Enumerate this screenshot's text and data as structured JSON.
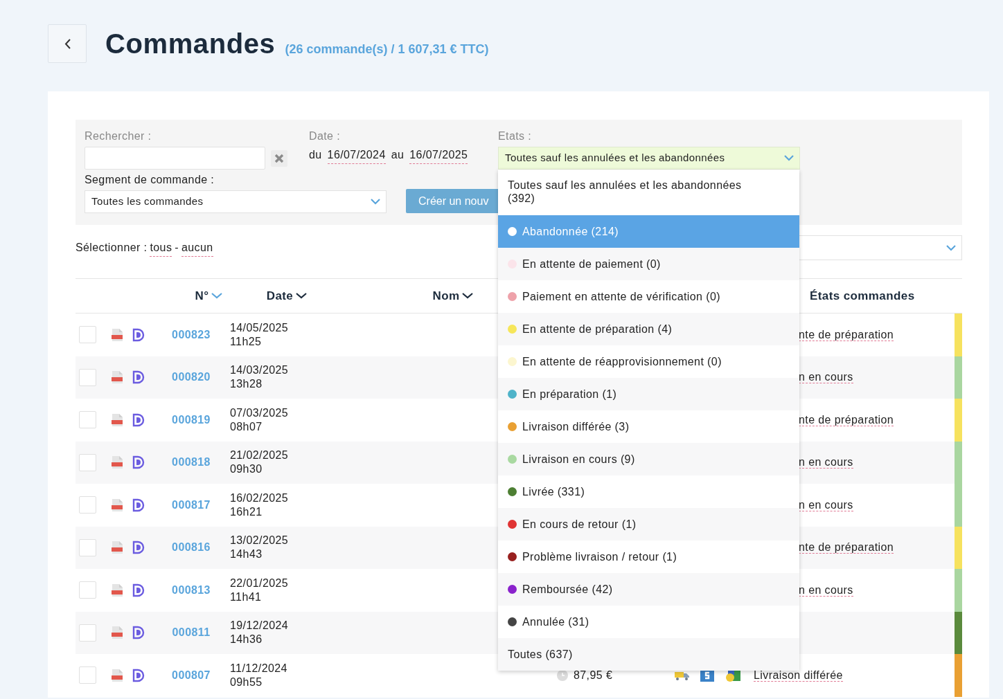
{
  "header": {
    "title": "Commandes",
    "summary": "(26 commande(s) / 1 607,31 €  TTC)"
  },
  "filters": {
    "search": {
      "label": "Rechercher :"
    },
    "date": {
      "label": "Date :",
      "from_prefix": "du",
      "from": "16/07/2024",
      "to_prefix": "au",
      "to": "16/07/2025"
    },
    "states": {
      "label": "Etats :",
      "value": "Toutes sauf les annulées et les abandonnées",
      "expanded": true,
      "options": [
        {
          "label": "Toutes sauf les annulées et les abandonnées (392)",
          "selected": false
        },
        {
          "label": "Abandonnée (214)",
          "color": "#ffffff",
          "selected": true
        },
        {
          "label": "En attente de paiement (0)",
          "color": "#fbe4ea",
          "selected": false
        },
        {
          "label": "Paiement en attente de vérification (0)",
          "color": "#eea2aa",
          "selected": false
        },
        {
          "label": "En attente de préparation (4)",
          "color": "#f6e65a",
          "selected": false
        },
        {
          "label": "En attente de réapprovisionnement (0)",
          "color": "#fcf6cf",
          "selected": false
        },
        {
          "label": "En préparation (1)",
          "color": "#4fb3c9",
          "selected": false
        },
        {
          "label": "Livraison différée (3)",
          "color": "#e9a033",
          "selected": false
        },
        {
          "label": "Livraison en cours (9)",
          "color": "#a9d9a1",
          "selected": false
        },
        {
          "label": "Livrée (331)",
          "color": "#4d7f33",
          "selected": false
        },
        {
          "label": "En cours de retour (1)",
          "color": "#e03434",
          "selected": false
        },
        {
          "label": "Problème livraison / retour (1)",
          "color": "#98201f",
          "selected": false
        },
        {
          "label": "Remboursée (42)",
          "color": "#8a22cc",
          "selected": false
        },
        {
          "label": "Annulée (31)",
          "color": "#444444",
          "selected": false
        },
        {
          "label": "Toutes (637)",
          "selected": false
        }
      ]
    },
    "segment": {
      "label": "Segment de commande :",
      "value": "Toutes les commandes"
    },
    "create_button": "Créer un nouv"
  },
  "select_bar": {
    "label": "Sélectionner :",
    "all": "tous",
    "separator": "-",
    "none": "aucun"
  },
  "table": {
    "columns": [
      {
        "label": "N°",
        "sorted": true
      },
      {
        "label": "Date",
        "sorted": false
      },
      {
        "label": "Nom",
        "sorted": false
      },
      {
        "label": "États commandes"
      }
    ],
    "rows": [
      {
        "kind": "covered",
        "number": "000823",
        "date": "14/05/2025",
        "time": "11h25",
        "state": "nte de préparation",
        "color": "#f6e25e",
        "checked": false
      },
      {
        "kind": "covered",
        "number": "000820",
        "date": "14/03/2025",
        "time": "13h28",
        "state": "n en cours",
        "color": "#a9d6a0",
        "checked": false
      },
      {
        "kind": "covered",
        "number": "000819",
        "date": "07/03/2025",
        "time": "08h07",
        "state": "nte de préparation",
        "color": "#f6e25e",
        "checked": false
      },
      {
        "kind": "covered",
        "number": "000818",
        "date": "21/02/2025",
        "time": "09h30",
        "state": "n en cours",
        "color": "#a9d6a0",
        "checked": false
      },
      {
        "kind": "covered",
        "number": "000817",
        "date": "16/02/2025",
        "time": "16h21",
        "state": "n en cours",
        "color": "#a9d6a0",
        "checked": false
      },
      {
        "kind": "covered",
        "number": "000816",
        "date": "13/02/2025",
        "time": "14h43",
        "state": "nte de préparation",
        "color": "#f6e25e",
        "checked": false
      },
      {
        "kind": "covered",
        "number": "000813",
        "date": "22/01/2025",
        "time": "11h41",
        "state": "n en cours",
        "color": "#a9d6a0",
        "checked": false
      },
      {
        "kind": "covered",
        "number": "000811",
        "date": "19/12/2024",
        "time": "14h36",
        "color": "#5a8a3c",
        "checked": false
      },
      {
        "kind": "full",
        "number": "000807",
        "date": "11/12/2024",
        "time": "09h55",
        "amount": "87,95 €",
        "state": "Livraison différée",
        "color": "#e9a033",
        "checked": false
      }
    ]
  }
}
